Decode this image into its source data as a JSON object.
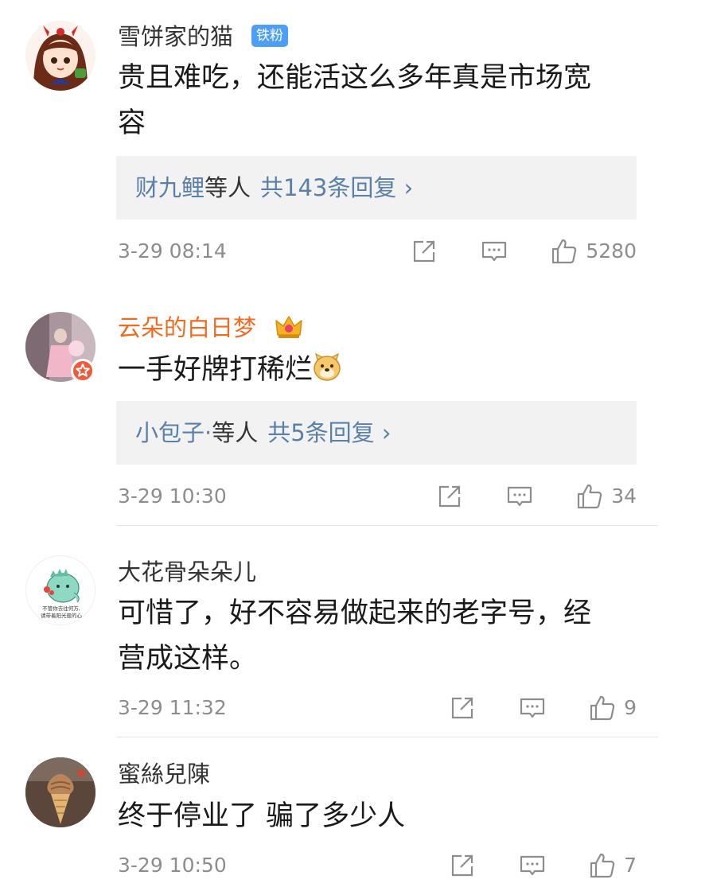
{
  "comments": [
    {
      "username": "雪饼家的猫",
      "badge": "铁粉",
      "content_lines": [
        "贵且难吃，还能活这么多年真是市场宽",
        "容"
      ],
      "reply": {
        "names": "财九鲤",
        "suffix": "等人",
        "count_text": "共143条回复 ›"
      },
      "time": "3-29 08:14",
      "likes": "5280"
    },
    {
      "username": "云朵的白日梦",
      "content_lines": [
        "一手好牌打稀烂"
      ],
      "reply": {
        "names": "小包子·",
        "suffix": "等人",
        "count_text": "共5条回复 ›"
      },
      "time": "3-29 10:30",
      "likes": "34"
    },
    {
      "username": "大花骨朵朵儿",
      "avatar_caption_lines": [
        "不管你去往何方,",
        "请带着阳光般的心"
      ],
      "content_lines": [
        "可惜了，好不容易做起来的老字号，经",
        "营成这样。"
      ],
      "time": "3-29 11:32",
      "likes": "9"
    },
    {
      "username": "蜜絲兒陳",
      "content_lines": [
        "终于停业了 骗了多少人"
      ],
      "time": "3-29 10:50",
      "likes": "7"
    }
  ],
  "colors": {
    "link": "#5a7fa9",
    "vip_name": "#ee6b1f",
    "meta_gray": "#8d8d8d",
    "fan_badge": "#4d9ff5"
  },
  "icons": {
    "share": "share-icon",
    "comment": "comment-icon",
    "like": "thumbs-up-icon",
    "vip": "crown-icon",
    "emoji": "doge-emoji-icon",
    "verified": "verified-star-icon"
  }
}
